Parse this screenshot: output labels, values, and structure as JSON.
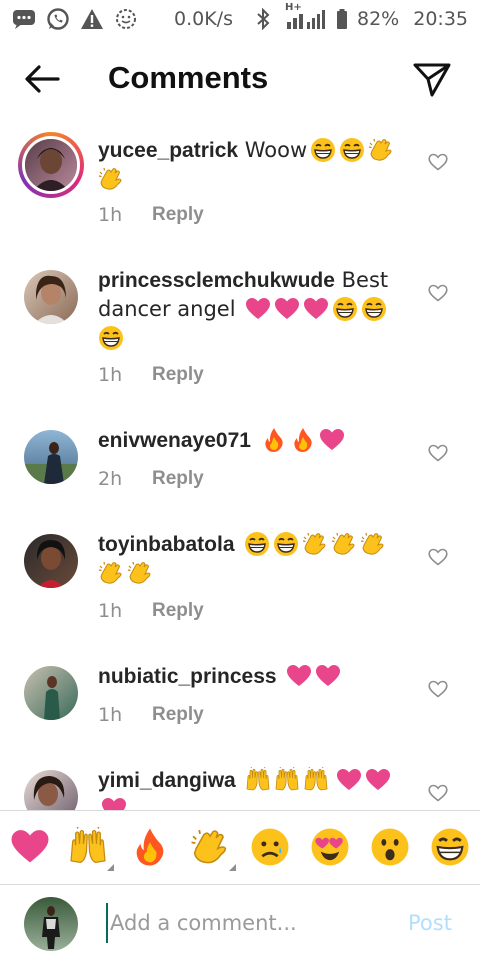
{
  "status_bar": {
    "speed": "0.0K/s",
    "network": "H+",
    "battery": "82%",
    "time": "20:35",
    "icons": [
      "chat-icon",
      "whatsapp-icon",
      "warning-icon",
      "smiley-icon",
      "bluetooth-icon",
      "signal-icon",
      "battery-icon"
    ]
  },
  "header": {
    "title": "Comments",
    "back_icon": "arrow-left-icon",
    "send_icon": "paper-plane-icon"
  },
  "comments": [
    {
      "username": "yucee_patrick",
      "text": " Woow",
      "emojis": [
        "grin",
        "grin",
        "clap",
        "clap"
      ],
      "time": "1h",
      "reply": "Reply",
      "story_ring": true
    },
    {
      "username": "princessclemchukwude",
      "text": " Best dancer angel ",
      "emojis": [
        "heart",
        "heart",
        "heart",
        "grin",
        "grin",
        "grin"
      ],
      "time": "1h",
      "reply": "Reply",
      "story_ring": false
    },
    {
      "username": "enivwenaye071",
      "text": " ",
      "emojis": [
        "fire",
        "fire",
        "heart"
      ],
      "time": "2h",
      "reply": "Reply",
      "story_ring": false
    },
    {
      "username": "toyinbabatola",
      "text": " ",
      "emojis": [
        "grin",
        "grin",
        "clap",
        "clap",
        "clap",
        "clap",
        "clap"
      ],
      "time": "1h",
      "reply": "Reply",
      "story_ring": false
    },
    {
      "username": "nubiatic_princess",
      "text": " ",
      "emojis": [
        "heart",
        "heart"
      ],
      "time": "1h",
      "reply": "Reply",
      "story_ring": false
    },
    {
      "username": "yimi_dangiwa",
      "text": " ",
      "emojis": [
        "raised-hands",
        "raised-hands",
        "raised-hands",
        "heart",
        "heart",
        "heart"
      ],
      "time": "",
      "reply": "",
      "story_ring": false
    }
  ],
  "quick_emojis": [
    "heart",
    "raised-hands",
    "fire",
    "clap",
    "sad",
    "heart-eyes",
    "surprised",
    "grin"
  ],
  "composer": {
    "placeholder": "Add a comment...",
    "post_label": "Post"
  },
  "colors": {
    "heart": "#e8458b",
    "link_disabled": "#b2dffc",
    "meta_gray": "#8e8e8e",
    "divider": "#dbdbdb"
  }
}
